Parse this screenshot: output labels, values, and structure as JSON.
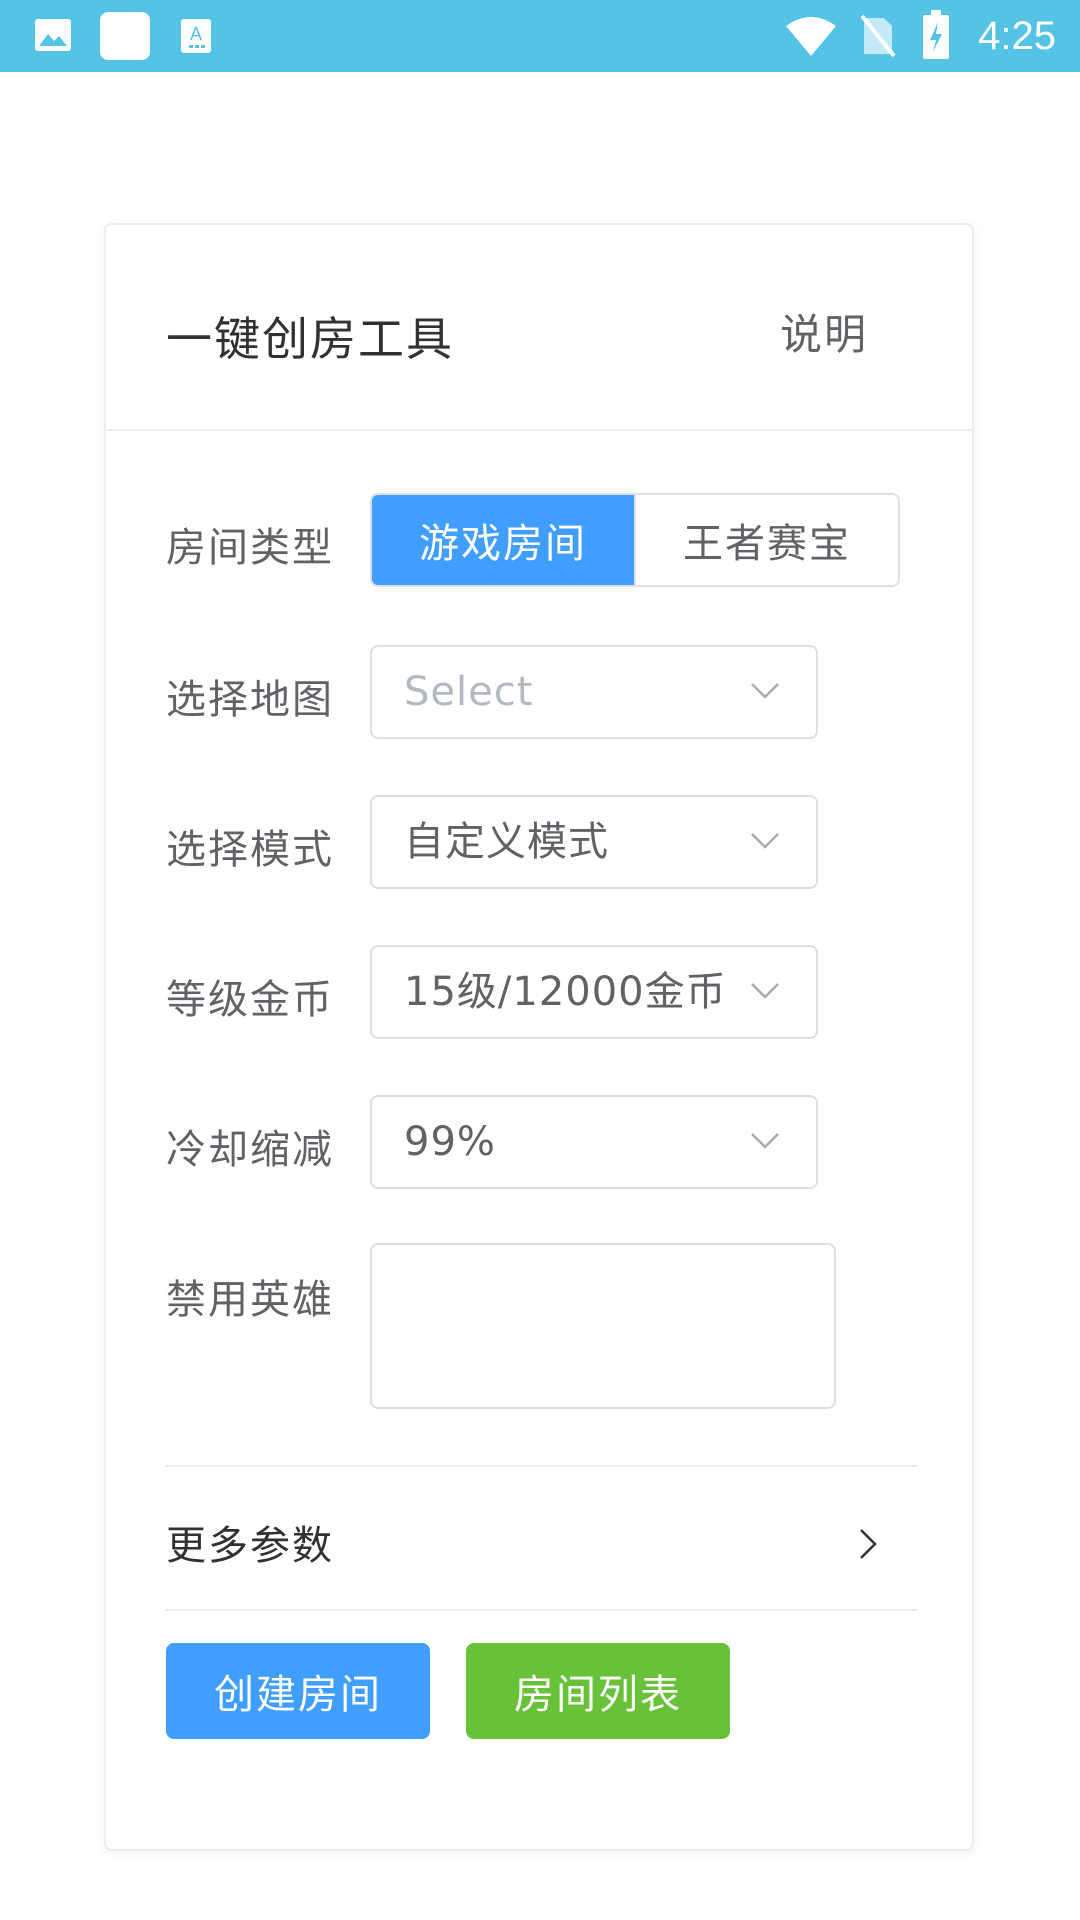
{
  "status_bar": {
    "time": "4:25",
    "icons": [
      "image-icon",
      "white-square-icon",
      "a-keyboard-icon",
      "wifi-icon",
      "no-sim-icon",
      "battery-charging-icon"
    ]
  },
  "card": {
    "title": "一键创房工具",
    "explain_link": "说明"
  },
  "form": {
    "room_type": {
      "label": "房间类型",
      "options": [
        "游戏房间",
        "王者赛宝"
      ],
      "selected": "游戏房间"
    },
    "map": {
      "label": "选择地图",
      "placeholder": "Select"
    },
    "mode": {
      "label": "选择模式",
      "value": "自定义模式"
    },
    "level_gold": {
      "label": "等级金币",
      "value": "15级/12000金币"
    },
    "cooldown": {
      "label": "冷却缩减",
      "value": "99%"
    },
    "ban_heroes": {
      "label": "禁用英雄",
      "value": ""
    }
  },
  "more": {
    "label": "更多参数"
  },
  "actions": {
    "create": "创建房间",
    "list": "房间列表"
  },
  "colors": {
    "status_bar": "#54c3e6",
    "primary": "#409eff",
    "success": "#67c23a",
    "border": "#dcdfe6"
  }
}
